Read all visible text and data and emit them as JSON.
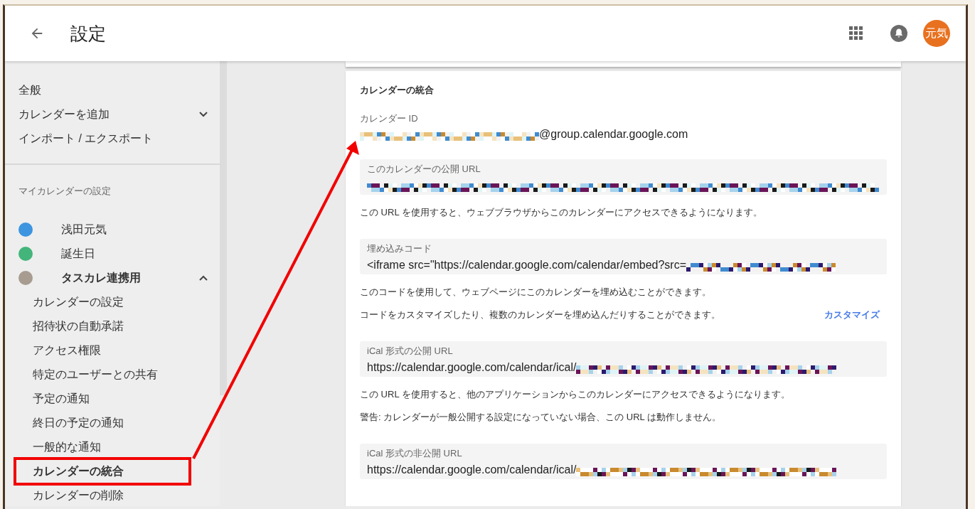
{
  "header": {
    "title": "設定",
    "avatar": "元気"
  },
  "sidebar": {
    "top_items": [
      {
        "label": "全般"
      },
      {
        "label": "カレンダーを追加",
        "expanded": false
      },
      {
        "label": "インポート / エクスポート"
      }
    ],
    "section_title": "マイカレンダーの設定",
    "calendars": [
      {
        "name": "浅田元気",
        "color": "#3d95e0"
      },
      {
        "name": "誕生日",
        "color": "#43b57a"
      },
      {
        "name": "タスカレ連携用",
        "color": "#a89c90",
        "expanded": true,
        "children": [
          {
            "label": "カレンダーの設定",
            "highlighted": false
          },
          {
            "label": "招待状の自動承諾",
            "highlighted": false
          },
          {
            "label": "アクセス権限",
            "highlighted": false
          },
          {
            "label": "特定のユーザーとの共有",
            "highlighted": false
          },
          {
            "label": "予定の通知",
            "highlighted": false
          },
          {
            "label": "終日の予定の通知",
            "highlighted": false
          },
          {
            "label": "一般的な通知",
            "highlighted": false
          },
          {
            "label": "カレンダーの統合",
            "highlighted": true
          },
          {
            "label": "カレンダーの削除",
            "highlighted": false
          }
        ]
      }
    ]
  },
  "card": {
    "title": "カレンダーの統合",
    "items": [
      {
        "kind": "id",
        "label": "カレンダー ID",
        "value": "@group.calendar.google.com"
      },
      {
        "kind": "field",
        "label": "このカレンダーの公開 URL"
      },
      {
        "kind": "note",
        "text": "この URL を使用すると、ウェブブラウザからこのカレンダーにアクセスできるようになります。"
      },
      {
        "kind": "field",
        "label": "埋め込みコード",
        "value": "<iframe src=\"https://calendar.google.com/calendar/embed?src="
      },
      {
        "kind": "note",
        "text": "このコードを使用して、ウェブページにこのカレンダーを埋め込むことができます。"
      },
      {
        "kind": "note",
        "text": "コードをカスタマイズしたり、複数のカレンダーを埋め込んだりすることができます。",
        "link": "カスタマイズ"
      },
      {
        "kind": "field",
        "label": "iCal 形式の公開 URL",
        "value": "https://calendar.google.com/calendar/ical/"
      },
      {
        "kind": "note",
        "text": "この URL を使用すると、他のアプリケーションからこのカレンダーにアクセスできるようになります。"
      },
      {
        "kind": "note",
        "text": "警告: カレンダーが一般公開する設定になっていない場合、この URL は動作しません。"
      },
      {
        "kind": "field",
        "label": "iCal 形式の非公開 URL",
        "value": "https://calendar.google.com/calendar/ical/"
      }
    ]
  }
}
